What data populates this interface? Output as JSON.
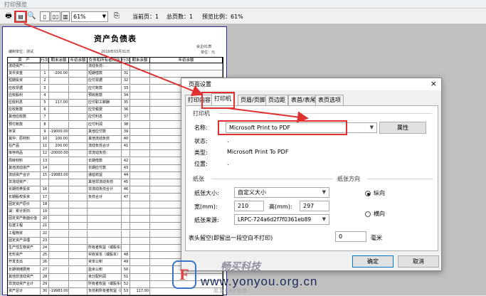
{
  "window": {
    "title": "打印预览"
  },
  "toolbar": {
    "zoom_value": "61%",
    "current_page_label": "当前页：1",
    "total_pages_label": "总页数：1",
    "scale_label": "预览比例：61%"
  },
  "report": {
    "title": "资产负债表",
    "meta_left": "编制单位：测试",
    "meta_mid": "2019年03月31日",
    "meta_right": "会企01表",
    "unit": "单位：元",
    "headers": [
      "资　产",
      "行次",
      "期末余额",
      "年初余额",
      "负债和所有者权益",
      "行次",
      "期末余额",
      "年初余额"
    ],
    "rows": [
      [
        "流动资产：",
        "",
        "",
        "",
        "流动负债：",
        "",
        "",
        ""
      ],
      [
        "货币资金",
        "1",
        "-200.00",
        "",
        "短期借款",
        "31",
        "",
        ""
      ],
      [
        "短期投资",
        "2",
        "",
        "",
        "应付票据",
        "32",
        "",
        ""
      ],
      [
        "应收票据",
        "3",
        "",
        "",
        "应付账款",
        "33",
        "",
        ""
      ],
      [
        "应收股利",
        "4",
        "",
        "",
        "预收账款",
        "34",
        "",
        ""
      ],
      [
        "应收利息",
        "5",
        "117.00",
        "",
        "应付职工薪酬",
        "35",
        "",
        ""
      ],
      [
        "应收账款",
        "6",
        "",
        "",
        "应交税费",
        "36",
        "",
        ""
      ],
      [
        "其他应收款",
        "7",
        "",
        "",
        "应付利息",
        "37",
        "",
        ""
      ],
      [
        "预付账款",
        "8",
        "",
        "",
        "应付利润",
        "38",
        "",
        ""
      ],
      [
        "存货",
        "9",
        "-19000.00",
        "",
        "其他应付款",
        "39",
        "",
        ""
      ],
      [
        "其中：原材料",
        "10",
        "100.00",
        "",
        "其他流动负债",
        "40",
        "",
        ""
      ],
      [
        "在产品",
        "11",
        "200.00",
        "",
        "流动负债合计",
        "41",
        "",
        ""
      ],
      [
        "库存商品",
        "12",
        "-20000.00",
        "",
        "非流动负债：",
        "",
        "",
        ""
      ],
      [
        "周转材料",
        "13",
        "",
        "",
        "长期借款",
        "42",
        "",
        ""
      ],
      [
        "其他流动资产",
        "14",
        "",
        "",
        "长期应付款",
        "43",
        "",
        ""
      ],
      [
        "流动资产合计",
        "15",
        "-19983.00",
        "",
        "递延收益",
        "44",
        "",
        ""
      ],
      [
        "非流动资产：",
        "",
        "",
        "",
        "其他非流动负债",
        "45",
        "",
        ""
      ],
      [
        "长期债券投资",
        "16",
        "",
        "",
        "非流动负债合计",
        "46",
        "",
        ""
      ],
      [
        "长期股权投资",
        "17",
        "",
        "",
        "负债合计",
        "47",
        "",
        ""
      ],
      [
        "固定资产原价",
        "18",
        "",
        "",
        "",
        "",
        "",
        ""
      ],
      [
        "减：累计折旧",
        "19",
        "",
        "",
        "",
        "",
        "",
        ""
      ],
      [
        "固定资产账面价值",
        "20",
        "",
        "",
        "",
        "",
        "",
        ""
      ],
      [
        "在建工程",
        "21",
        "",
        "",
        "",
        "",
        "",
        ""
      ],
      [
        "工程物资",
        "22",
        "",
        "",
        "",
        "",
        "",
        ""
      ],
      [
        "固定资产清理",
        "23",
        "",
        "",
        "",
        "",
        "",
        ""
      ],
      [
        "生产性生物资产",
        "24",
        "",
        "",
        "所有者权益（或股东权益）：",
        "",
        "",
        ""
      ],
      [
        "无形资产",
        "25",
        "",
        "",
        "实收资本（或股本）",
        "48",
        "",
        ""
      ],
      [
        "开发支出",
        "26",
        "",
        "",
        "资本公积",
        "49",
        "",
        ""
      ],
      [
        "长期待摊费用",
        "27",
        "",
        "",
        "盈余公积",
        "50",
        "",
        ""
      ],
      [
        "其他非流动资产",
        "28",
        "",
        "",
        "未分配利润",
        "51",
        "",
        ""
      ],
      [
        "非流动资产合计",
        "29",
        "",
        "",
        "所有者权益（或股东权益）合计",
        "52",
        "",
        ""
      ],
      [
        "资产总计",
        "30",
        "-19983.00",
        "",
        "负债和所有者权益（或股东权益）总计",
        "53",
        "117.00",
        ""
      ]
    ]
  },
  "dialog": {
    "title": "页面设置",
    "close": "×",
    "tabs": [
      "打印内容",
      "打印机",
      "页眉/页脚",
      "页边距",
      "表首/表尾",
      "表页选项"
    ],
    "printer_group": "打印机",
    "name_label": "名称:",
    "printer_name": "Microsoft Print to PDF",
    "properties_button": "属性",
    "status_label": "状态:",
    "status_value": ".",
    "type_label": "类型:",
    "type_value": "Microsoft Print To PDF",
    "location_label": "位置:",
    "location_value": ".",
    "paper_group": "纸张",
    "paper_size_label": "纸张大小:",
    "paper_size_value": "自定义大小",
    "width_label": "宽(mm):",
    "width_value": "210",
    "height_label": "高(mm):",
    "height_value": "297",
    "source_label": "纸张来源:",
    "source_value": "LRPC-724a6d2f7f0361eb89",
    "orientation_group": "纸张方向",
    "portrait_label": "纵向",
    "landscape_label": "横向",
    "gap_label": "表头留空(即留出一段空白不打印)",
    "gap_value": "0",
    "gap_unit": "毫米",
    "ok_button": "确定",
    "cancel_button": "取消"
  },
  "watermark": {
    "logo": "F",
    "cn": "畅买科技",
    "url": "www.yonyou.org.cn",
    "sub": "用友ERP软件"
  },
  "colors": {
    "annotation_red": "#e03030",
    "page_border": "#2c2c9c",
    "primary_blue": "#0078d7"
  }
}
